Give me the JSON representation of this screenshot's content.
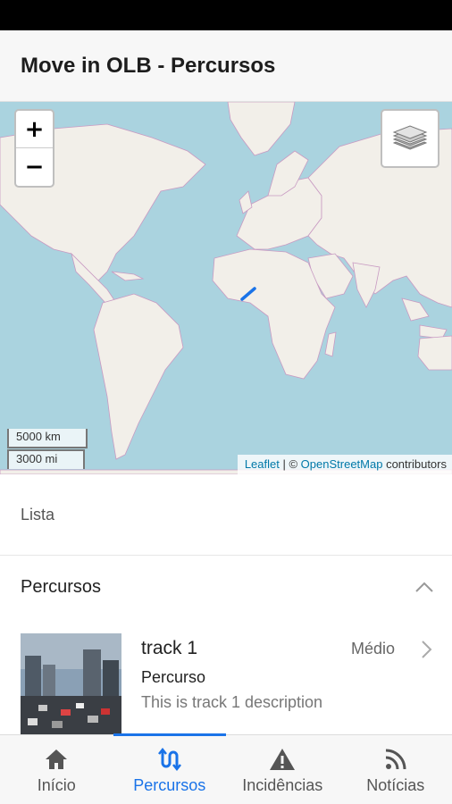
{
  "app": {
    "title": "Move in OLB - Percursos"
  },
  "map": {
    "zoom_in_label": "+",
    "zoom_out_label": "−",
    "scale_km": "5000 km",
    "scale_mi": "3000 mi",
    "attribution_leaflet": "Leaflet",
    "attribution_sep": " | © ",
    "attribution_osm": "OpenStreetMap",
    "attribution_suffix": " contributors",
    "colors": {
      "water": "#aad3df",
      "land": "#f2efe9",
      "borders": "#c89ac2",
      "track": "#1a73e8"
    }
  },
  "lista": {
    "label": "Lista"
  },
  "percursos": {
    "title": "Percursos",
    "items": [
      {
        "name": "track 1",
        "level": "Médio",
        "type": "Percurso",
        "description": "This is track 1 description"
      }
    ]
  },
  "nav": {
    "tabs": [
      {
        "label": "Início",
        "icon": "home-icon",
        "active": false
      },
      {
        "label": "Percursos",
        "icon": "route-icon",
        "active": true
      },
      {
        "label": "Incidências",
        "icon": "warning-icon",
        "active": false
      },
      {
        "label": "Notícias",
        "icon": "rss-feed-icon",
        "active": false
      }
    ],
    "accent": "#1a73e8"
  }
}
